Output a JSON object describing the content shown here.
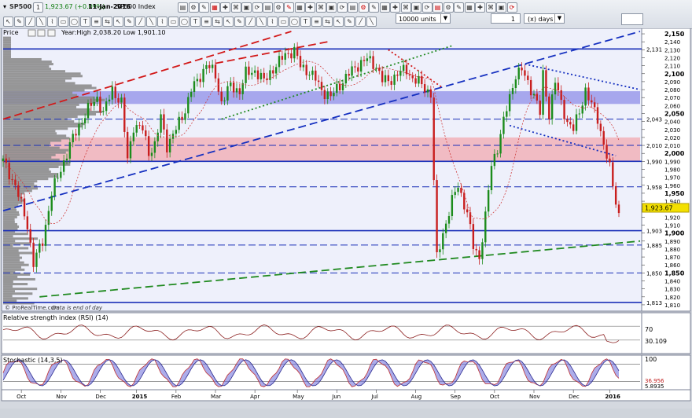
{
  "toolbar": {
    "symbol": "SP500",
    "quote": "1,923.67 (+0.09%)",
    "date": "11-Jan-2016",
    "name": "SP500 Index",
    "units": "10000 units",
    "days_value": "1",
    "days_unit": "(x) days"
  },
  "price_panel": {
    "title": "Price",
    "stats": "Year:High 2,038.20 Low 1,901.10",
    "current_price": "1,923.67",
    "footer_note": "© ProRealTime.com",
    "footer_note2": "Data is end of day"
  },
  "level_labels": [
    "2,131",
    "2,043",
    "2,010",
    "1,990",
    "1,958",
    "1,903",
    "1,885",
    "1,850",
    "1,813"
  ],
  "rsi_panel": {
    "title": "Relative strength index (RSI) (14)",
    "value": "30.109",
    "tick": "70"
  },
  "stoch_panel": {
    "title": "Stochastic (14,3,5)",
    "value1": "36.956",
    "value2": "5.8935",
    "tick": "100"
  },
  "chart_data": {
    "type": "candlestick",
    "instrument": "SP500",
    "x_tick_labels": [
      "Oct",
      "Nov",
      "Dec",
      "2015",
      "Feb",
      "Mar",
      "Apr",
      "May",
      "Jun",
      "Jul",
      "Aug",
      "Sep",
      "Oct",
      "Nov",
      "Dec",
      "2016"
    ],
    "price_axis_ticks": [
      "2,150",
      "2,140",
      "2,130",
      "2,120",
      "2,110",
      "2,100",
      "2,090",
      "2,080",
      "2,070",
      "2,060",
      "2,050",
      "2,040",
      "2,030",
      "2,020",
      "2,010",
      "2,000",
      "1,990",
      "1,980",
      "1,970",
      "1,960",
      "1,950",
      "1,940",
      "1,930",
      "1,920",
      "1,910",
      "1,900",
      "1,890",
      "1,880",
      "1,870",
      "1,860",
      "1,850",
      "1,840",
      "1,830",
      "1,820",
      "1,810"
    ],
    "ylim": [
      1806,
      2153
    ],
    "horizontal_levels": [
      2131,
      2043,
      2010,
      1990,
      1958,
      1903,
      1885,
      1850,
      1813
    ],
    "zones": [
      {
        "name": "resistance",
        "low": 2062,
        "high": 2078,
        "color": "#8f8fe8"
      },
      {
        "name": "support",
        "low": 1990,
        "high": 2020,
        "color": "#f2a9b0"
      }
    ],
    "price_path": [
      [
        0,
        1990
      ],
      [
        4,
        1960
      ],
      [
        8,
        1910
      ],
      [
        10,
        1862
      ],
      [
        13,
        1890
      ],
      [
        16,
        1950
      ],
      [
        19,
        1980
      ],
      [
        22,
        2010
      ],
      [
        25,
        2035
      ],
      [
        28,
        2055
      ],
      [
        31,
        2070
      ],
      [
        33,
        2050
      ],
      [
        36,
        2080
      ],
      [
        39,
        2063
      ],
      [
        41,
        1992
      ],
      [
        43,
        2035
      ],
      [
        46,
        2030
      ],
      [
        48,
        2002
      ],
      [
        50,
        2010
      ],
      [
        52,
        2045
      ],
      [
        54,
        2010
      ],
      [
        57,
        2030
      ],
      [
        60,
        2055
      ],
      [
        62,
        2080
      ],
      [
        64,
        2090
      ],
      [
        67,
        2112
      ],
      [
        70,
        2098
      ],
      [
        72,
        2064
      ],
      [
        75,
        2085
      ],
      [
        78,
        2078
      ],
      [
        80,
        2100
      ],
      [
        83,
        2104
      ],
      [
        86,
        2090
      ],
      [
        88,
        2102
      ],
      [
        91,
        2114
      ],
      [
        93,
        2125
      ],
      [
        96,
        2128
      ],
      [
        98,
        2110
      ],
      [
        100,
        2105
      ],
      [
        103,
        2093
      ],
      [
        105,
        2080
      ],
      [
        108,
        2070
      ],
      [
        110,
        2082
      ],
      [
        113,
        2095
      ],
      [
        116,
        2108
      ],
      [
        118,
        2114
      ],
      [
        120,
        2118
      ],
      [
        123,
        2110
      ],
      [
        125,
        2092
      ],
      [
        127,
        2090
      ],
      [
        130,
        2100
      ],
      [
        133,
        2105
      ],
      [
        135,
        2094
      ],
      [
        137,
        2089
      ],
      [
        139,
        2082
      ],
      [
        141,
        2075
      ],
      [
        142,
        1965
      ],
      [
        143,
        1868
      ],
      [
        145,
        1900
      ],
      [
        148,
        1940
      ],
      [
        150,
        1960
      ],
      [
        153,
        1925
      ],
      [
        155,
        1883
      ],
      [
        157,
        1870
      ],
      [
        159,
        1920
      ],
      [
        161,
        1985
      ],
      [
        163,
        2008
      ],
      [
        165,
        2040
      ],
      [
        167,
        2070
      ],
      [
        169,
        2100
      ],
      [
        171,
        2104
      ],
      [
        173,
        2088
      ],
      [
        175,
        2075
      ],
      [
        177,
        2050
      ],
      [
        178,
        2098
      ],
      [
        180,
        2050
      ],
      [
        182,
        2090
      ],
      [
        184,
        2062
      ],
      [
        186,
        2040
      ],
      [
        188,
        2030
      ],
      [
        190,
        2052
      ],
      [
        192,
        2080
      ],
      [
        194,
        2060
      ],
      [
        196,
        2044
      ],
      [
        198,
        2012
      ],
      [
        200,
        1980
      ],
      [
        202,
        1940
      ],
      [
        203,
        1923.67
      ]
    ],
    "trendlines": [
      {
        "name": "red-channel",
        "points": [
          [
            0,
            2043
          ],
          [
            95,
            2153
          ]
        ],
        "style": "dashed",
        "color": "#d21818"
      },
      {
        "name": "red-channel-upper",
        "points": [
          [
            70,
            2113
          ],
          [
            107,
            2140
          ]
        ],
        "style": "dashed",
        "color": "#d21818"
      },
      {
        "name": "blue-trend",
        "points": [
          [
            0,
            1928
          ],
          [
            210,
            2153
          ]
        ],
        "style": "dashed",
        "color": "#1530c0"
      },
      {
        "name": "blue-top",
        "points": [
          [
            172,
            2112
          ],
          [
            210,
            2080
          ]
        ],
        "style": "dotted",
        "color": "#1530c0"
      },
      {
        "name": "blue-mid",
        "points": [
          [
            167,
            2035
          ],
          [
            202,
            1997
          ]
        ],
        "style": "dotted",
        "color": "#1530c0"
      },
      {
        "name": "green-lower",
        "points": [
          [
            12,
            1820
          ],
          [
            210,
            1890
          ]
        ],
        "style": "dashed",
        "color": "#208a20"
      },
      {
        "name": "green-upper",
        "points": [
          [
            72,
            2043
          ],
          [
            148,
            2135
          ]
        ],
        "style": "dotted",
        "color": "#208a20"
      },
      {
        "name": "red-down",
        "points": [
          [
            127,
            2130
          ],
          [
            145,
            2082
          ]
        ],
        "style": "dotted",
        "color": "#d21818"
      }
    ],
    "rsi_levels": [
      70,
      30
    ],
    "stochastic_levels": [
      80,
      20
    ]
  }
}
